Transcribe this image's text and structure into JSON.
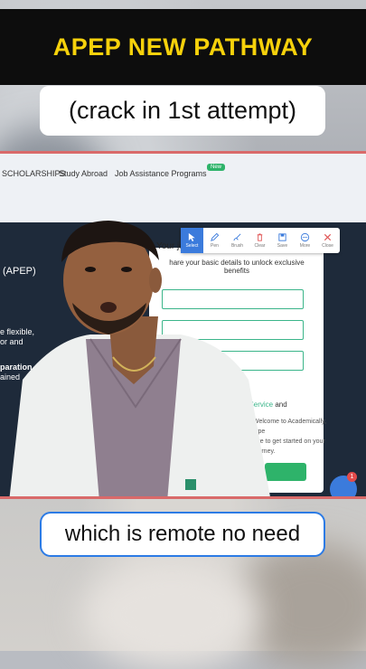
{
  "title": "APEP NEW PATHWAY",
  "caption_top": "(crack in 1st attempt)",
  "caption_bottom": "which is remote no need",
  "website": {
    "nav": {
      "scholarships": "SCHOLARSHIPS",
      "study_abroad": "Study Abroad",
      "job_assistance": "Job Assistance Programs",
      "new_badge": "New"
    },
    "left": {
      "apep": "(APEP)",
      "line1": "e flexible,",
      "line2": "or and",
      "line3": "paration",
      "line4": "ained"
    },
    "form": {
      "heading": "Your jo",
      "hint": "hare your basic details to unlock exclusive benefits",
      "terms_link": "f Service",
      "terms_tail": " and",
      "chat_message": "Welcome to Academically, type\nnge to get started on your\njourney.",
      "chat_badge": "1"
    },
    "toolbar": {
      "items": [
        {
          "label": "Select",
          "icon": "cursor-icon"
        },
        {
          "label": "Pen",
          "icon": "pen-icon"
        },
        {
          "label": "Brush",
          "icon": "brush-icon"
        },
        {
          "label": "Clear",
          "icon": "trash-icon"
        },
        {
          "label": "Save",
          "icon": "save-icon"
        },
        {
          "label": "More",
          "icon": "more-icon"
        },
        {
          "label": "Close",
          "icon": "close-icon"
        }
      ]
    }
  },
  "colors": {
    "title_text": "#f6d10b",
    "title_band": "#0d0d0d",
    "accent_green": "#2eb36a",
    "frame_border": "#d96a6a"
  }
}
